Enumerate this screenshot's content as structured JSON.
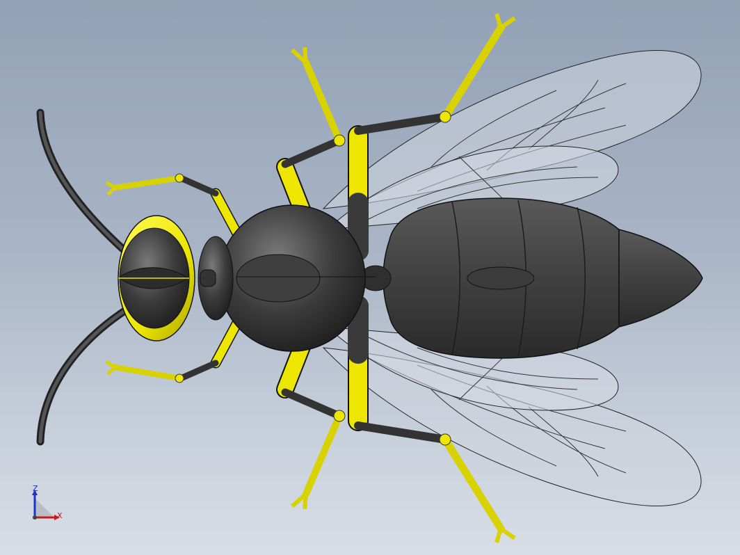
{
  "viewport": {
    "background_top": "#93a1b6",
    "background_bottom": "#d8dee6"
  },
  "model": {
    "subject": "wasp",
    "body_color": "#3f3f3f",
    "leg_color": "#f2ee00",
    "wing_color": "#cfd5de"
  },
  "triad": {
    "z_label": "Z",
    "x_label": "X",
    "z_color": "#1a33c8",
    "x_color": "#c81a1a"
  }
}
